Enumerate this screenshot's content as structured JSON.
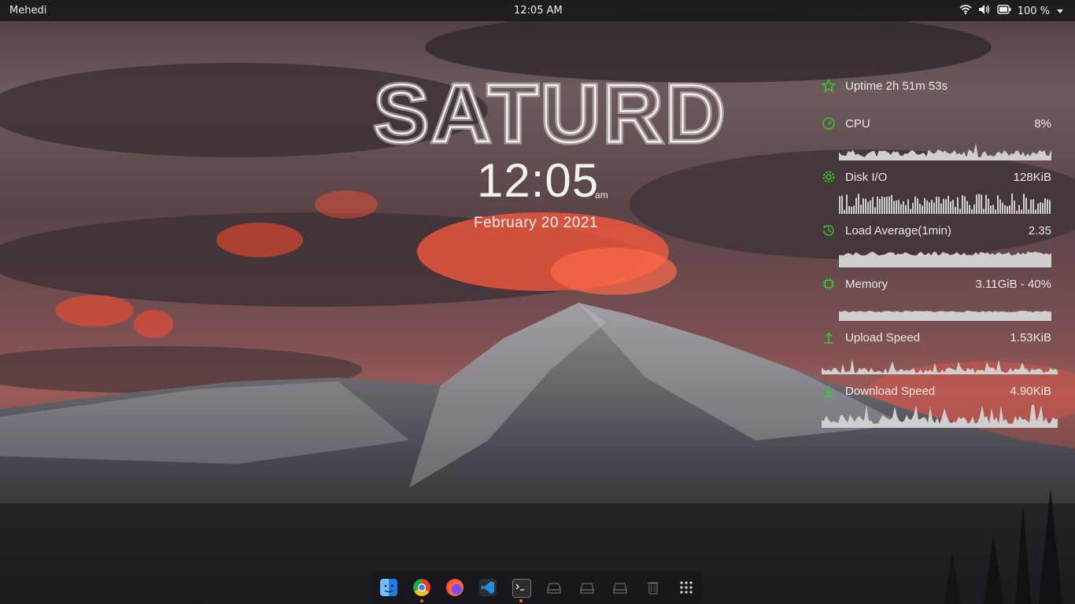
{
  "topbar": {
    "user": "Mehedi",
    "clock": "12:05 AM",
    "battery": "100 %",
    "icons": [
      "wifi-icon",
      "volume-icon",
      "battery-icon",
      "chevron-down-icon"
    ]
  },
  "desktop_clock": {
    "day": "SATURD",
    "time": "12:05",
    "ampm": "am",
    "date": "February 20 2021"
  },
  "monitor": {
    "uptime": {
      "label": "Uptime 2h 51m 53s",
      "icon": "star-icon"
    },
    "cpu": {
      "label": "CPU",
      "value": "8%",
      "icon": "gauge-icon"
    },
    "disk": {
      "label": "Disk I/O",
      "value": "128KiB",
      "icon": "gear-icon"
    },
    "load": {
      "label": "Load Average(1min)",
      "value": "2.35",
      "icon": "history-icon"
    },
    "memory": {
      "label": "Memory",
      "value": "3.11GiB - 40%",
      "icon": "chip-icon"
    },
    "upload": {
      "label": "Upload Speed",
      "value": "1.53KiB",
      "icon": "arrow-up-icon"
    },
    "download": {
      "label": "Download Speed",
      "value": "4.90KiB",
      "icon": "arrow-down-icon"
    },
    "accent": "#2fd12f"
  },
  "dock": {
    "apps": [
      "finder-icon",
      "chrome-icon",
      "firefox-icon",
      "vscode-icon",
      "terminal-icon",
      "drive-icon",
      "drive-icon",
      "drive-icon",
      "trash-icon",
      "app-grid-icon"
    ]
  }
}
